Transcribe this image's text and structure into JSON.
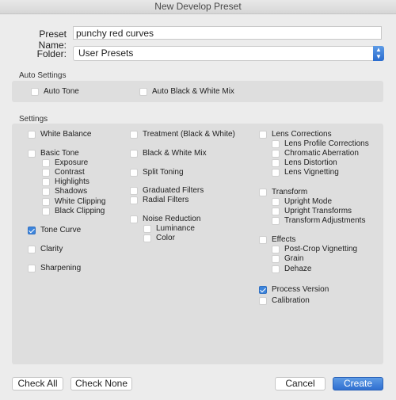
{
  "window": {
    "title": "New Develop Preset"
  },
  "form": {
    "preset_name_label": "Preset Name:",
    "preset_name_value": "punchy red curves",
    "folder_label": "Folder:",
    "folder_value": "User Presets"
  },
  "auto_settings": {
    "title": "Auto Settings",
    "items": [
      {
        "label": "Auto Tone",
        "checked": false
      },
      {
        "label": "Auto Black & White Mix",
        "checked": false
      }
    ]
  },
  "settings": {
    "title": "Settings",
    "col1": [
      {
        "label": "White Balance",
        "checked": false
      },
      {
        "label": "Basic Tone",
        "checked": false
      },
      {
        "label": "Exposure",
        "checked": false
      },
      {
        "label": "Contrast",
        "checked": false
      },
      {
        "label": "Highlights",
        "checked": false
      },
      {
        "label": "Shadows",
        "checked": false
      },
      {
        "label": "White Clipping",
        "checked": false
      },
      {
        "label": "Black Clipping",
        "checked": false
      },
      {
        "label": "Tone Curve",
        "checked": true
      },
      {
        "label": "Clarity",
        "checked": false
      },
      {
        "label": "Sharpening",
        "checked": false
      }
    ],
    "col2": [
      {
        "label": "Treatment (Black & White)",
        "checked": false
      },
      {
        "label": "Black & White Mix",
        "checked": false
      },
      {
        "label": "Split Toning",
        "checked": false
      },
      {
        "label": "Graduated Filters",
        "checked": false
      },
      {
        "label": "Radial Filters",
        "checked": false
      },
      {
        "label": "Noise Reduction",
        "checked": false
      },
      {
        "label": "Luminance",
        "checked": false
      },
      {
        "label": "Color",
        "checked": false
      }
    ],
    "col3": [
      {
        "label": "Lens Corrections",
        "checked": false
      },
      {
        "label": "Lens Profile Corrections",
        "checked": false
      },
      {
        "label": "Chromatic Aberration",
        "checked": false
      },
      {
        "label": "Lens Distortion",
        "checked": false
      },
      {
        "label": "Lens Vignetting",
        "checked": false
      },
      {
        "label": "Transform",
        "checked": false
      },
      {
        "label": "Upright Mode",
        "checked": false
      },
      {
        "label": "Upright Transforms",
        "checked": false
      },
      {
        "label": "Transform Adjustments",
        "checked": false
      },
      {
        "label": "Effects",
        "checked": false
      },
      {
        "label": "Post-Crop Vignetting",
        "checked": false
      },
      {
        "label": "Grain",
        "checked": false
      },
      {
        "label": "Dehaze",
        "checked": false
      },
      {
        "label": "Process Version",
        "checked": true
      },
      {
        "label": "Calibration",
        "checked": false
      }
    ]
  },
  "buttons": {
    "check_all": "Check All",
    "check_none": "Check None",
    "cancel": "Cancel",
    "create": "Create"
  },
  "colors": {
    "accent": "#3d85dc"
  }
}
